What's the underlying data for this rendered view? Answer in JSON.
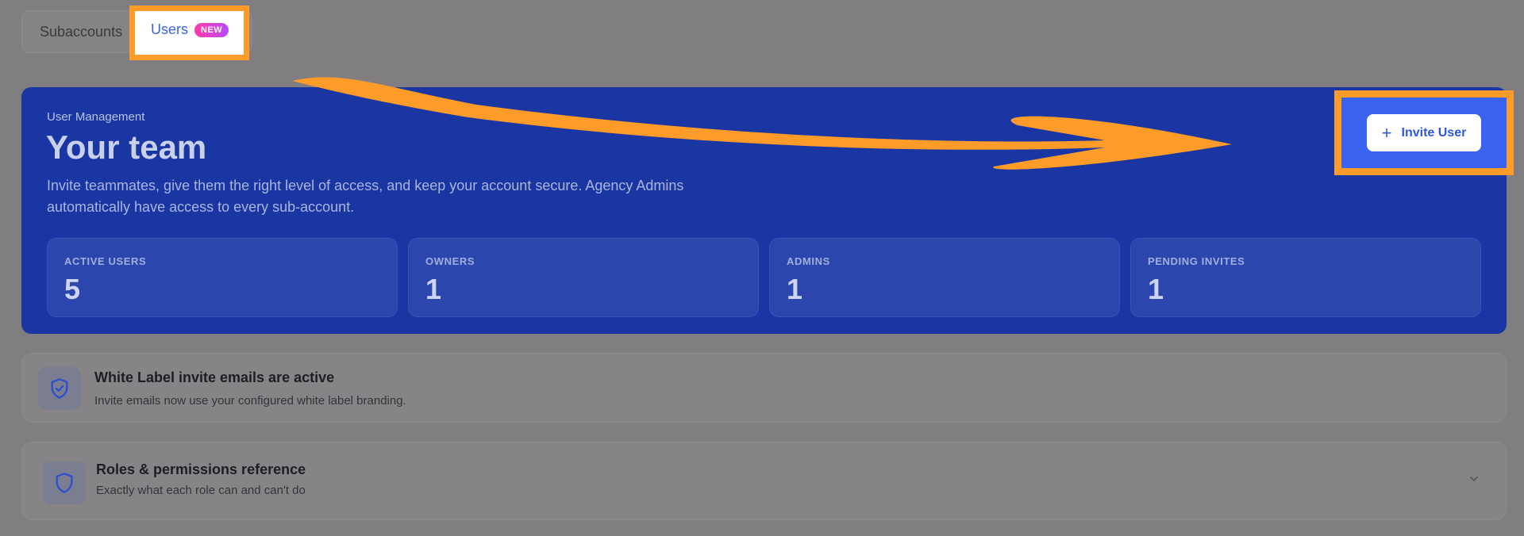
{
  "tabs": {
    "subaccounts_label": "Subaccounts",
    "users_label": "Users",
    "users_badge": "NEW"
  },
  "hero": {
    "eyebrow": "User Management",
    "title": "Your team",
    "description": "Invite teammates, give them the right level of access, and keep your account secure. Agency Admins automatically have access to every sub-account.",
    "invite_label": "Invite User",
    "stats": [
      {
        "label": "ACTIVE USERS",
        "value": "5"
      },
      {
        "label": "OWNERS",
        "value": "1"
      },
      {
        "label": "ADMINS",
        "value": "1"
      },
      {
        "label": "PENDING INVITES",
        "value": "1"
      }
    ]
  },
  "cards": {
    "white_label": {
      "title": "White Label invite emails are active",
      "subtitle": "Invite emails now use your configured white label branding."
    },
    "roles": {
      "title": "Roles & permissions reference",
      "subtitle": "Exactly what each role can and can't do"
    }
  },
  "icons": {
    "shield_check": "shield-check-icon",
    "shield": "shield-icon",
    "chevron": "chevron-down-icon",
    "plus": "plus-icon"
  },
  "colors": {
    "accent": "#3b63e8",
    "hero_bg": "#1a36a3",
    "highlight": "#ff9b28",
    "badge_start": "#ff3aa5",
    "badge_end": "#b54bff"
  }
}
